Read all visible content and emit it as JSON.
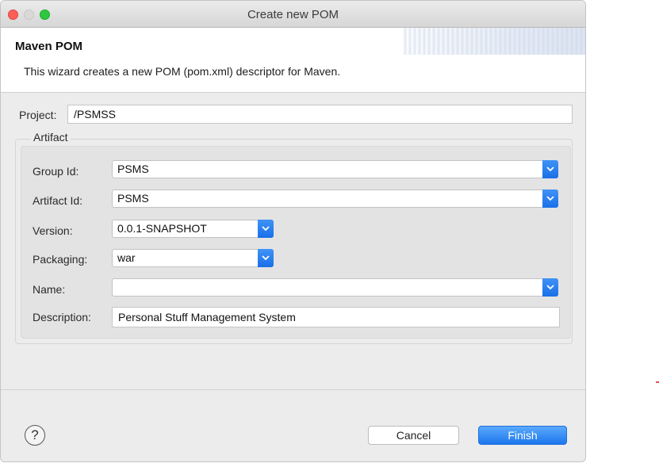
{
  "window": {
    "title": "Create new POM"
  },
  "banner": {
    "title": "Maven POM",
    "description": "This wizard creates a new POM (pom.xml) descriptor for Maven."
  },
  "project": {
    "label": "Project:",
    "value": "/PSMSS"
  },
  "artifact": {
    "group_title": "Artifact",
    "fields": {
      "group_id": {
        "label": "Group Id:",
        "value": "PSMS"
      },
      "artifact_id": {
        "label": "Artifact Id:",
        "value": "PSMS"
      },
      "version": {
        "label": "Version:",
        "value": "0.0.1-SNAPSHOT"
      },
      "packaging": {
        "label": "Packaging:",
        "value": "war"
      },
      "name": {
        "label": "Name:",
        "value": ""
      },
      "description": {
        "label": "Description:",
        "value": "Personal Stuff Management System"
      }
    }
  },
  "footer": {
    "help_glyph": "?",
    "cancel_label": "Cancel",
    "finish_label": "Finish"
  },
  "colors": {
    "accent": "#1a6fe8",
    "close": "#fd5f57",
    "maximize": "#2ec83f"
  },
  "icons": [
    "close-dot-icon",
    "minimize-dot-icon",
    "maximize-dot-icon",
    "chevron-down-icon",
    "help-icon"
  ]
}
